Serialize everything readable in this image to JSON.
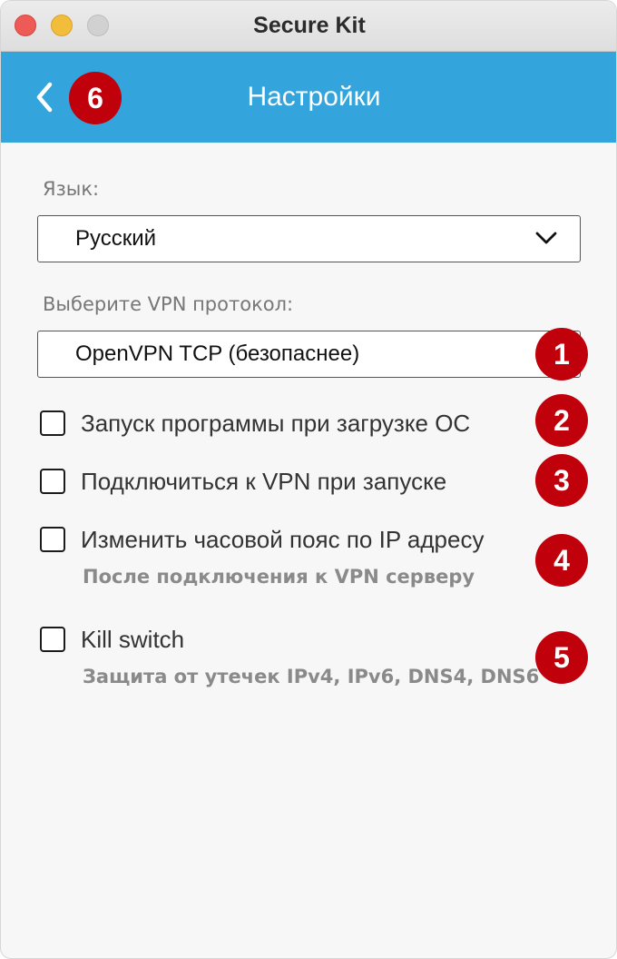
{
  "window": {
    "title": "Secure Kit"
  },
  "header": {
    "title": "Настройки"
  },
  "language": {
    "label": "Язык:",
    "selected": "Русский"
  },
  "protocol": {
    "label": "Выберите VPN протокол:",
    "selected": "OpenVPN TCP (безопаснее)"
  },
  "options": [
    {
      "label": "Запуск программы при загрузке ОС",
      "sub": "",
      "checked": false
    },
    {
      "label": "Подключиться к VPN при запуске",
      "sub": "",
      "checked": false
    },
    {
      "label": "Изменить часовой пояс по IP адресу",
      "sub": "После подключения к VPN серверу",
      "checked": false
    },
    {
      "label": "Kill switch",
      "sub": "Защита от утечек IPv4, IPv6, DNS4, DNS6",
      "checked": false
    }
  ],
  "badges": [
    "1",
    "2",
    "3",
    "4",
    "5",
    "6"
  ],
  "colors": {
    "accent": "#34a5dc",
    "badge": "#c0000b"
  },
  "icons": {
    "back": "chevron-left-icon",
    "dropdown": "chevron-down-icon"
  }
}
